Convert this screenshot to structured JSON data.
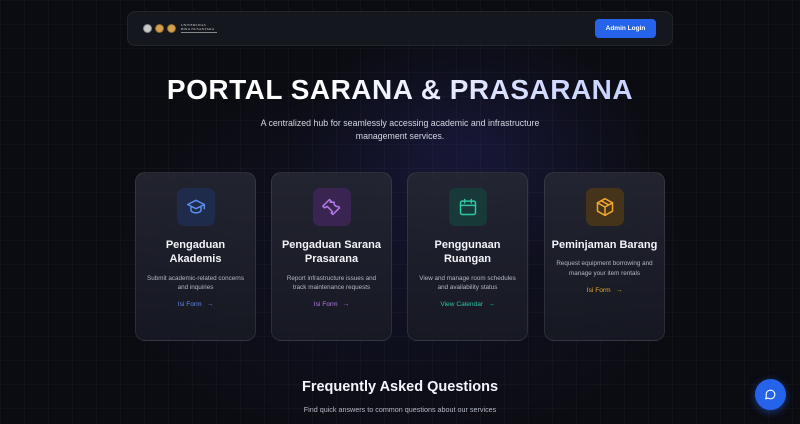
{
  "navbar": {
    "logo_text_line1": "UNIVERSITAS",
    "logo_text_line2": "BINA NUSANTARA",
    "admin_button": "Admin Login"
  },
  "hero": {
    "title": "PORTAL SARANA & PRASARANA",
    "subtitle": "A centralized hub for seamlessly accessing academic and infrastructure management services."
  },
  "cards": [
    {
      "icon": "graduation-cap-icon",
      "title": "Pengaduan Akademis",
      "description": "Submit academic-related concerns and inquiries",
      "link": "Isi Form",
      "accent": "#5b8def",
      "icon_bg": "#1e2b4a"
    },
    {
      "icon": "wrench-icon",
      "title": "Pengaduan Sarana Prasarana",
      "description": "Report infrastructure issues and track maintenance requests",
      "link": "Isi Form",
      "accent": "#b57ae8",
      "icon_bg": "#3a2452"
    },
    {
      "icon": "calendar-icon",
      "title": "Penggunaan Ruangan",
      "description": "View and manage room schedules and availability status",
      "link": "View Calendar",
      "accent": "#2fc6a6",
      "icon_bg": "#173a38"
    },
    {
      "icon": "box-icon",
      "title": "Peminjaman Barang",
      "description": "Request equipment borrowing and manage your item rentals",
      "link": "Isi Form",
      "accent": "#f0a830",
      "icon_bg": "#45331a"
    }
  ],
  "faq": {
    "title": "Frequently Asked Questions",
    "subtitle": "Find quick answers to common questions about our services"
  },
  "chat": {
    "icon": "chat-bubble-icon"
  }
}
